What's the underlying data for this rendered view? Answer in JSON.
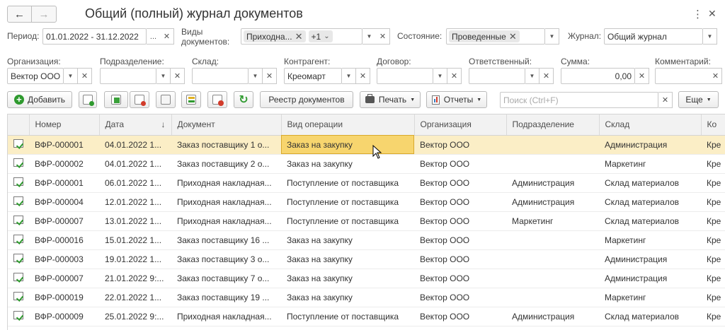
{
  "window": {
    "title": "Общий (полный) журнал документов",
    "nav_back": "←",
    "nav_forward": "→",
    "more_icon": "⋮",
    "close_icon": "✕"
  },
  "filters": {
    "period_label": "Период:",
    "period_value": "01.01.2022 - 31.12.2022",
    "period_select": "...",
    "doc_types_label": "Виды документов:",
    "doc_types_tags": [
      "Приходна...",
      "+1"
    ],
    "state_label": "Состояние:",
    "state_tag": "Проведенные",
    "journal_label": "Журнал:",
    "journal_value": "Общий журнал",
    "organization_label": "Организация:",
    "organization_value": "Вектор ООО",
    "department_label": "Подразделение:",
    "department_value": "",
    "warehouse_label": "Склад:",
    "warehouse_value": "",
    "counterparty_label": "Контрагент:",
    "counterparty_value": "Креомарт",
    "contract_label": "Договор:",
    "contract_value": "",
    "responsible_label": "Ответственный:",
    "responsible_value": "",
    "sum_label": "Сумма:",
    "sum_value": "0,00",
    "comment_label": "Комментарий:",
    "comment_value": ""
  },
  "toolbar": {
    "add": "Добавить",
    "registry": "Реестр документов",
    "print": "Печать",
    "reports": "Отчеты",
    "search_placeholder": "Поиск (Ctrl+F)",
    "more": "Еще"
  },
  "table": {
    "columns": [
      "Номер",
      "Дата",
      "Документ",
      "Вид операции",
      "Организация",
      "Подразделение",
      "Склад",
      "Ко"
    ],
    "sort_indicator": "↓",
    "rows": [
      {
        "num": "ВФР-000001",
        "date": "04.01.2022 1...",
        "doc": "Заказ поставщику 1 о...",
        "op": "Заказ на закупку",
        "org": "Вектор ООО",
        "dept": "",
        "wh": "Администрация",
        "cp": "Кре"
      },
      {
        "num": "ВФР-000002",
        "date": "04.01.2022 1...",
        "doc": "Заказ поставщику 2 о...",
        "op": "Заказ на закупку",
        "org": "Вектор ООО",
        "dept": "",
        "wh": "Маркетинг",
        "cp": "Кре"
      },
      {
        "num": "ВФР-000001",
        "date": "06.01.2022 1...",
        "doc": "Приходная накладная...",
        "op": "Поступление от поставщика",
        "org": "Вектор ООО",
        "dept": "Администрация",
        "wh": "Склад материалов",
        "cp": "Кре"
      },
      {
        "num": "ВФР-000004",
        "date": "12.01.2022 1...",
        "doc": "Приходная накладная...",
        "op": "Поступление от поставщика",
        "org": "Вектор ООО",
        "dept": "Администрация",
        "wh": "Склад материалов",
        "cp": "Кре"
      },
      {
        "num": "ВФР-000007",
        "date": "13.01.2022 1...",
        "doc": "Приходная накладная...",
        "op": "Поступление от поставщика",
        "org": "Вектор ООО",
        "dept": "Маркетинг",
        "wh": "Склад материалов",
        "cp": "Кре"
      },
      {
        "num": "ВФР-000016",
        "date": "15.01.2022 1...",
        "doc": "Заказ поставщику 16 ...",
        "op": "Заказ на закупку",
        "org": "Вектор ООО",
        "dept": "",
        "wh": "Маркетинг",
        "cp": "Кре"
      },
      {
        "num": "ВФР-000003",
        "date": "19.01.2022 1...",
        "doc": "Заказ поставщику 3 о...",
        "op": "Заказ на закупку",
        "org": "Вектор ООО",
        "dept": "",
        "wh": "Администрация",
        "cp": "Кре"
      },
      {
        "num": "ВФР-000007",
        "date": "21.01.2022 9:...",
        "doc": "Заказ поставщику 7 о...",
        "op": "Заказ на закупку",
        "org": "Вектор ООО",
        "dept": "",
        "wh": "Администрация",
        "cp": "Кре"
      },
      {
        "num": "ВФР-000019",
        "date": "22.01.2022 1...",
        "doc": "Заказ поставщику 19 ...",
        "op": "Заказ на закупку",
        "org": "Вектор ООО",
        "dept": "",
        "wh": "Маркетинг",
        "cp": "Кре"
      },
      {
        "num": "ВФР-000009",
        "date": "25.01.2022 9:...",
        "doc": "Приходная накладная...",
        "op": "Поступление от поставщика",
        "org": "Вектор ООО",
        "dept": "Администрация",
        "wh": "Склад материалов",
        "cp": "Кре"
      }
    ]
  },
  "colors": {
    "selected_row": "#fbeec6",
    "selected_cell": "#f7d56e",
    "add_icon": "#2f9a2f"
  }
}
